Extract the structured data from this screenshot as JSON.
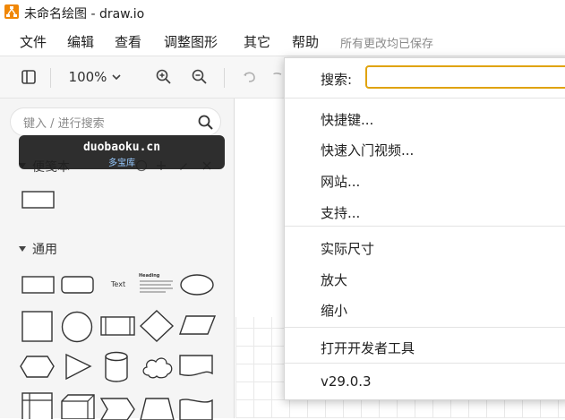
{
  "window": {
    "title": "未命名绘图 - draw.io"
  },
  "menubar": {
    "items": [
      "文件",
      "编辑",
      "查看",
      "调整图形",
      "其它",
      "帮助"
    ],
    "status": "所有更改均已保存"
  },
  "toolbar": {
    "zoom": "100%"
  },
  "sidebar": {
    "search_placeholder": "键入 / 进行搜索",
    "scratchpad_label": "便笺本",
    "general_label": "通用",
    "text_shape_label": "Text",
    "heading_shape_label": "Heading"
  },
  "watermark": {
    "line1": "duobaoku.cn",
    "line2": "多宝库"
  },
  "help_menu": {
    "search_label": "搜索:",
    "items": [
      "快捷键...",
      "快速入门视频...",
      "网站...",
      "支持...",
      "实际尺寸",
      "放大",
      "缩小",
      "打开开发者工具",
      "v29.0.3"
    ]
  },
  "colors": {
    "accent": "#e0a30b",
    "logo": "#f08705"
  }
}
